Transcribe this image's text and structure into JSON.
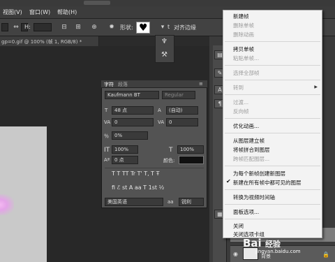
{
  "menubar": {
    "items": [
      "视图(V)",
      "窗口(W)",
      "帮助(H)"
    ]
  },
  "optbar": {
    "h_label": "H:",
    "shape_label": "形状:",
    "align_edges": "对齐边缘",
    "stroke_prefix": "t"
  },
  "document": {
    "tab": "gp=0.gif @ 100% (帧 1, RGB/8) *"
  },
  "character_panel": {
    "tabs": [
      "字符",
      "段落"
    ],
    "font_family": "Kaufmann BT",
    "font_style": "Regular",
    "font_size": "48 点",
    "leading": "(自动)",
    "kerning": "0",
    "tracking": "0",
    "tsume": "0%",
    "vertical_scale": "100%",
    "horizontal_scale": "100%",
    "baseline_shift": "0 点",
    "color_label": "颜色:",
    "glyph_row_1": "T  T  TT  Tr  T'  T,  T  Ŧ",
    "glyph_row_2": "fi  ℰ  st  A  aa  T  1st  ½",
    "language": "美国英语",
    "antialias_label": "aa",
    "antialias": "锐利"
  },
  "context_menu": {
    "items": [
      {
        "label": "新建帧",
        "disabled": false
      },
      {
        "label": "删除单帧",
        "disabled": true
      },
      {
        "label": "删除动画",
        "disabled": true
      },
      {
        "label": "拷贝单帧",
        "disabled": false
      },
      {
        "label": "粘贴单帧...",
        "disabled": true
      },
      {
        "label": "选择全部帧",
        "disabled": true
      },
      {
        "label": "转到",
        "disabled": true
      },
      {
        "label": "过渡...",
        "disabled": true
      },
      {
        "label": "反向帧",
        "disabled": true
      },
      {
        "label": "优化动画...",
        "disabled": false
      },
      {
        "label": "从图层建立帧",
        "disabled": false
      },
      {
        "label": "将帧拼合到图层",
        "disabled": false
      },
      {
        "label": "跨帧匹配图层...",
        "disabled": true
      },
      {
        "label": "为每个新帧创建新图层",
        "disabled": false
      },
      {
        "label": "新建在所有帧中都可见的图层",
        "disabled": false
      },
      {
        "label": "转换为视频时间轴",
        "disabled": false
      },
      {
        "label": "面板选项...",
        "disabled": false
      },
      {
        "label": "关闭",
        "disabled": false
      },
      {
        "label": "关闭选项卡组",
        "disabled": false
      }
    ]
  },
  "layers": {
    "bg_name": "背景"
  },
  "watermark": {
    "brand": "Bai",
    "brand2": "经验",
    "url": "jingyan.baidu.com"
  },
  "colors": {
    "menu_bg": "#f3f3f3",
    "panel_bg": "#535353",
    "canvas": "#c9c9c9"
  }
}
